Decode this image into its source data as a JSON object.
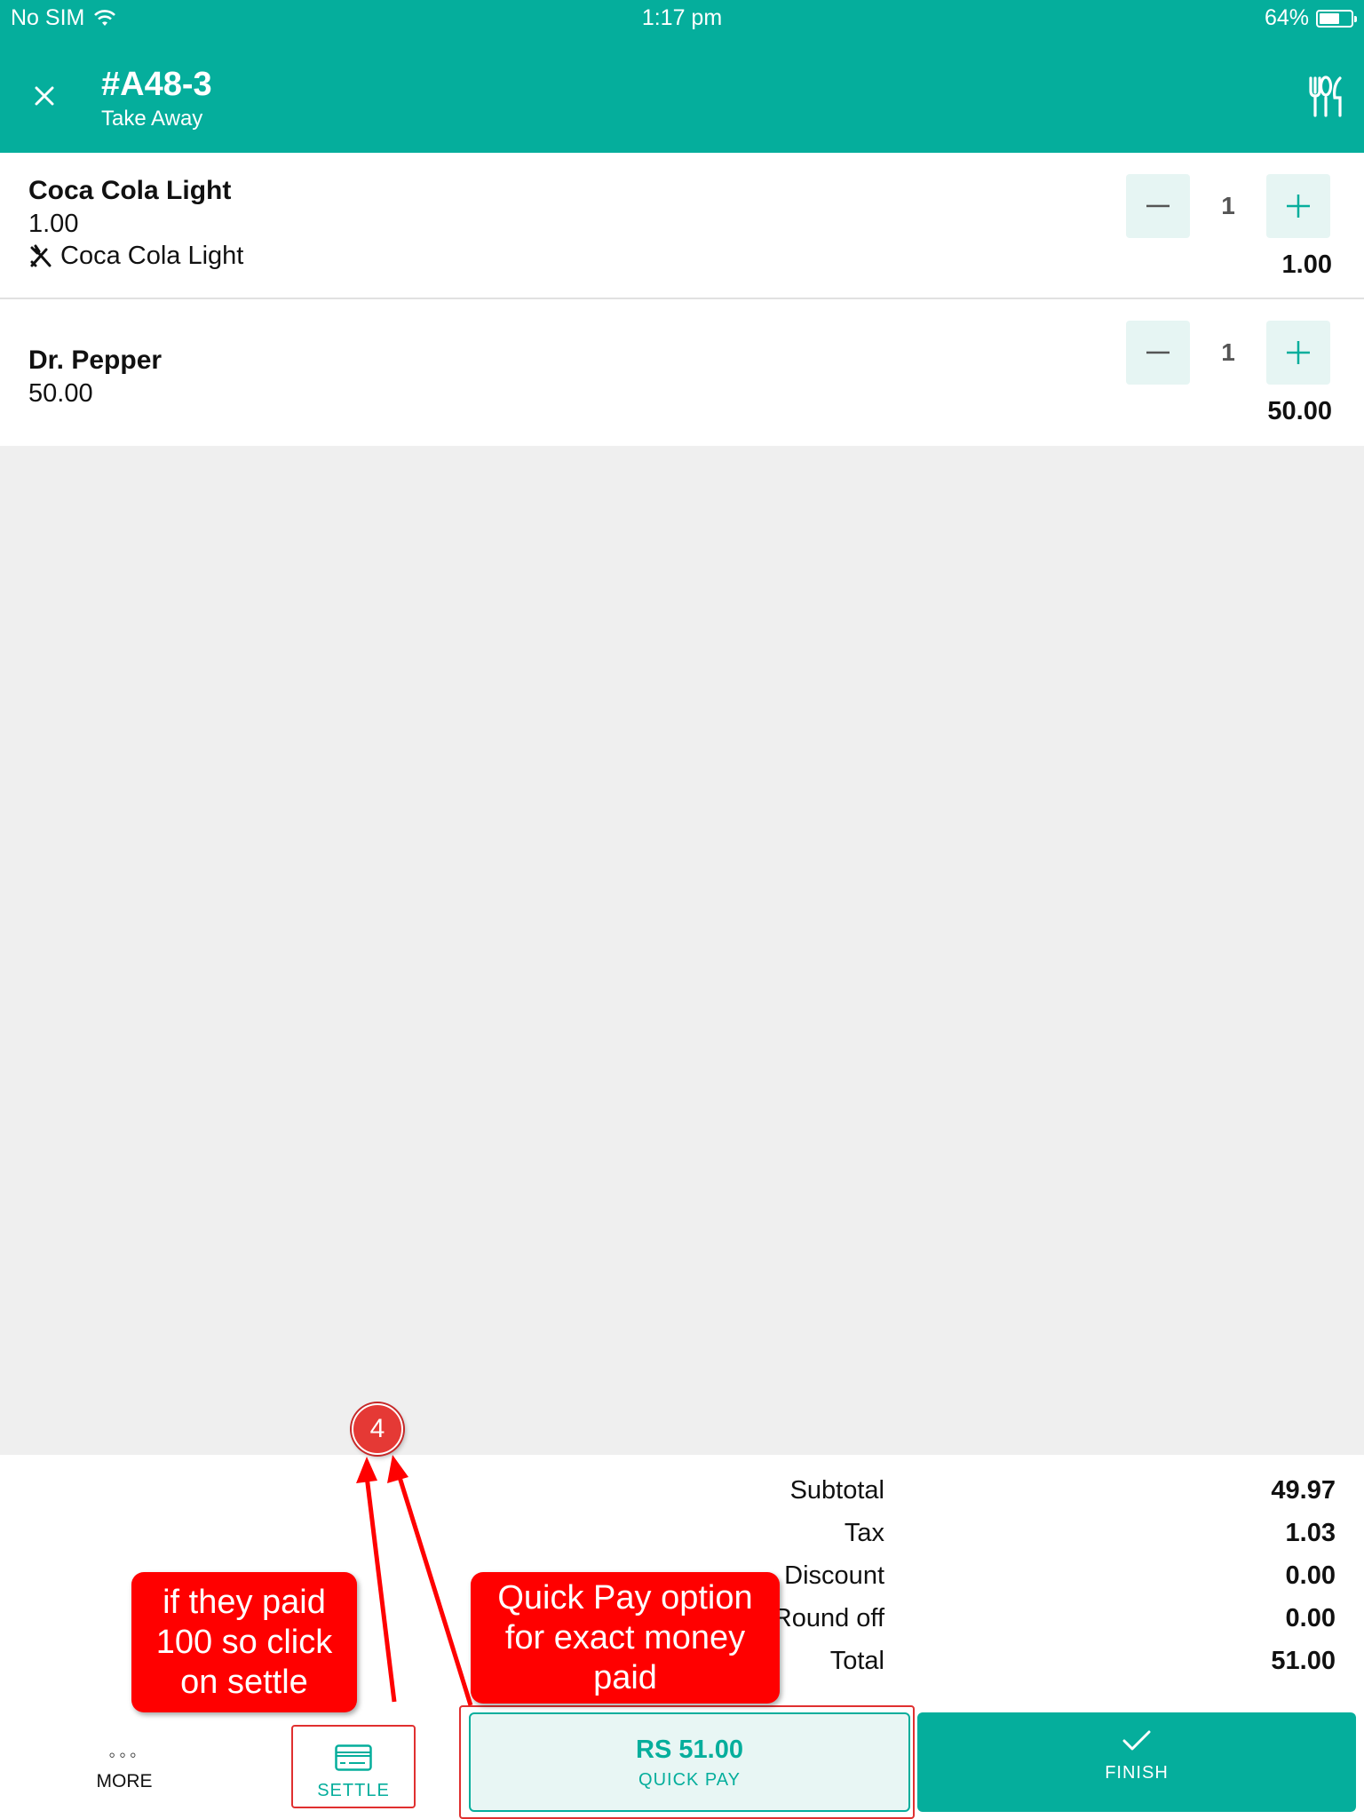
{
  "status_bar": {
    "carrier": "No SIM",
    "time": "1:17 pm",
    "battery": "64%",
    "battery_level": 0.64
  },
  "header": {
    "order_id": "#A48-3",
    "order_type": "Take Away"
  },
  "items": [
    {
      "name": "Coca Cola Light",
      "price": "1.00",
      "modifier": "Coca Cola Light",
      "qty": "1",
      "line_total": "1.00"
    },
    {
      "name": "Dr. Pepper",
      "price": "50.00",
      "qty": "1",
      "line_total": "50.00"
    }
  ],
  "totals": [
    {
      "label": "Subtotal",
      "value": "49.97"
    },
    {
      "label": "Tax",
      "value": "1.03"
    },
    {
      "label": "Discount",
      "value": "0.00"
    },
    {
      "label": "Round off",
      "value": "0.00"
    },
    {
      "label": "Total",
      "value": "51.00"
    }
  ],
  "bottom_bar": {
    "more_label": "MORE",
    "settle_label": "SETTLE",
    "quick_pay_amount": "RS 51.00",
    "quick_pay_label": "QUICK PAY",
    "finish_label": "FINISH"
  },
  "annotations": {
    "step_number": "4",
    "settle_callout": [
      "if they paid",
      "100 so click",
      "on settle"
    ],
    "quick_pay_callout": [
      "Quick Pay option",
      "for exact money",
      "paid"
    ]
  },
  "colors": {
    "brand": "#05ae9c",
    "annotation": "#ff0000"
  }
}
